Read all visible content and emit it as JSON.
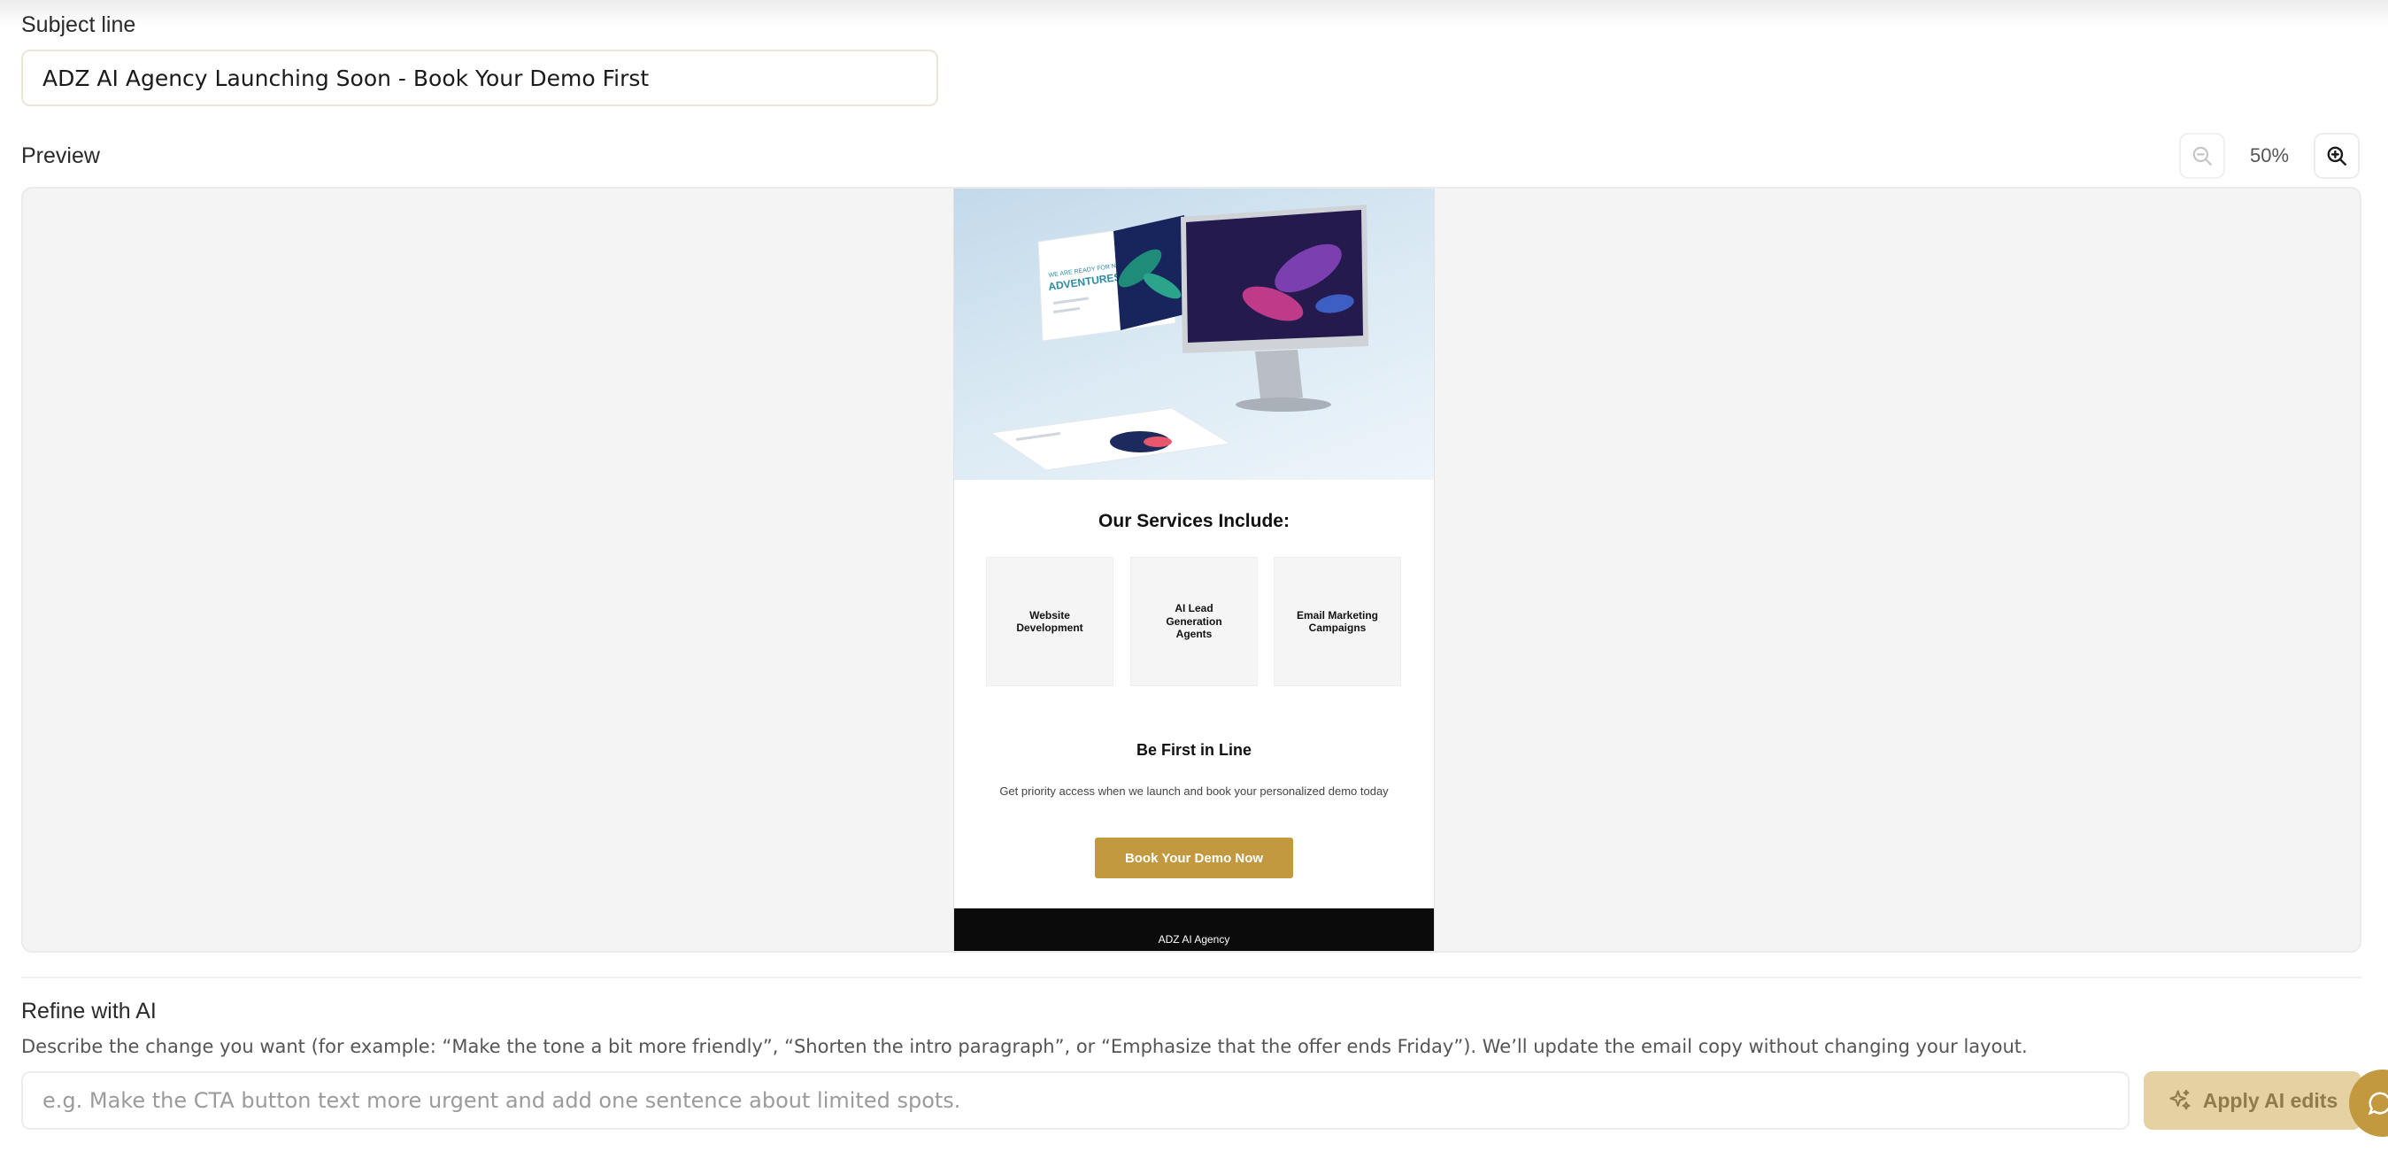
{
  "subject": {
    "label": "Subject line",
    "value": "ADZ AI Agency Launching Soon - Book Your Demo First"
  },
  "preview": {
    "label": "Preview",
    "zoom_level": "50%",
    "zoom_out_icon": "zoom-out-icon",
    "zoom_in_icon": "zoom-in-icon"
  },
  "email": {
    "hero_image_alt": "Website design displayed on desktop monitor and floating screens",
    "hero_headline_small": "WE ARE READY FOR NEW",
    "hero_headline_big": "ADVENTURES",
    "services_title": "Our Services Include:",
    "services": [
      {
        "label": "Website Development"
      },
      {
        "label": "AI Lead Generation Agents"
      },
      {
        "label": "Email Marketing Campaigns"
      }
    ],
    "first_title": "Be First in Line",
    "first_body": "Get priority access when we launch and book your personalized demo today",
    "cta_label": "Book Your Demo Now",
    "footer_text": "ADZ AI Agency",
    "accent_color": "#c3993f"
  },
  "refine": {
    "title": "Refine with AI",
    "description": "Describe the change you want (for example: “Make the tone a bit more friendly”, “Shorten the intro paragraph”, or “Emphasize that the offer ends Friday”). We’ll update the email copy without changing your layout.",
    "placeholder": "e.g. Make the CTA button text more urgent and add one sentence about limited spots.",
    "apply_label": "Apply AI edits",
    "apply_icon": "sparkle-icon"
  },
  "chat_icon": "chat-bubble-icon"
}
